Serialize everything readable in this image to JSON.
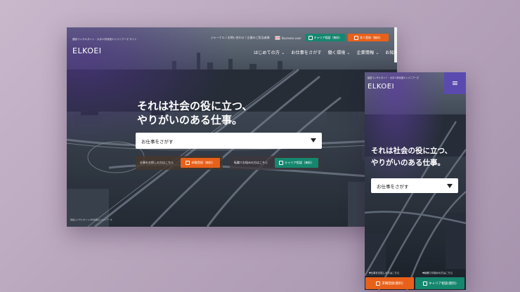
{
  "desktop": {
    "tagline": "建設コンサルタント・大手人材派遣エンジニアーズ サイト",
    "logo": "ELKOEI",
    "top_links": "ジャーナル / お問い合わせ / 企業のご担当者様",
    "language": "Business user",
    "btn_career": "キャリア相談（無料）",
    "btn_hire": "求人登録（無料）",
    "nav": [
      "はじめての方 ⌄",
      "お仕事をさがす",
      "働く環境 ⌄",
      "企業情報 ⌄",
      "お知らせ"
    ],
    "headline_line1": "それは社会の役に立つ、",
    "headline_line2": "やりがいのある仕事。",
    "search_label": "お仕事をさがす",
    "row1_text": "仕事をお探しの方はこちら",
    "row1_button": "求職登録（無料）",
    "row2_text": "転職でお悩みの方はこちら",
    "row2_button": "キャリア相談（無料）",
    "footer": "建設コンサルタント人材派遣エンジニアーズ"
  },
  "mobile": {
    "tagline": "建設コンサルタント・大手人材派遣エンジニアーズ",
    "logo": "ELKOEI",
    "menu_icon": "≡",
    "headline_line1": "それは社会の役に立つ、",
    "headline_line2": "やりがいのある仕事。",
    "search_label": "お仕事をさがす",
    "caption1": "▼仕事をお探しの方はこちら",
    "caption2": "▼転職でお悩みの方はこちら",
    "btn_hire": "求職登録(無料)",
    "btn_career": "キャリア相談(無料)"
  },
  "colors": {
    "teal": "#16876f",
    "orange": "#e8611a",
    "menu": "#5a4ab0"
  }
}
